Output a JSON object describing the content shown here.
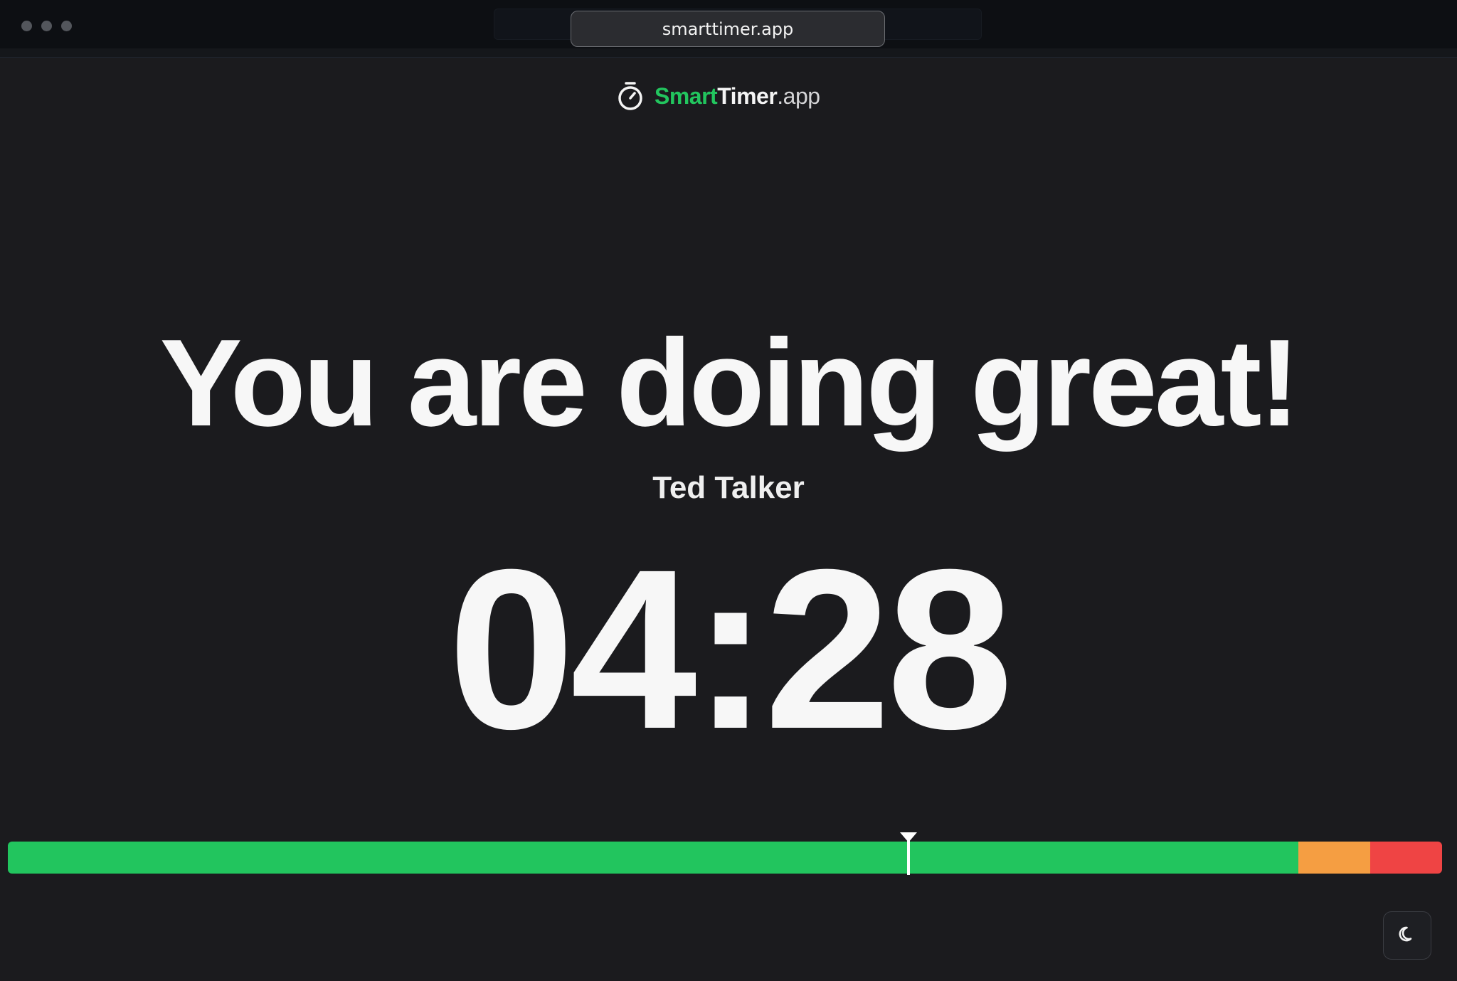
{
  "browser": {
    "url": "smarttimer.app"
  },
  "logo": {
    "smart": "Smart",
    "timer": "Timer",
    "app": ".app",
    "icon": "stopwatch-icon"
  },
  "main": {
    "headline": "You are doing great!",
    "speaker": "Ted Talker",
    "time": "04:28"
  },
  "progress": {
    "marker_fraction": 0.628,
    "segments": [
      {
        "status": "on-time",
        "color": "#22c55e",
        "fraction": 0.9
      },
      {
        "status": "warning",
        "color": "#f59e42",
        "fraction": 0.05
      },
      {
        "status": "overtime",
        "color": "#ef4444",
        "fraction": 0.05
      }
    ]
  },
  "theme_toggle": {
    "icon": "moon-icon"
  },
  "colors": {
    "background": "#1b1b1e",
    "accent": "#22c55e",
    "text": "#f7f7f7"
  }
}
